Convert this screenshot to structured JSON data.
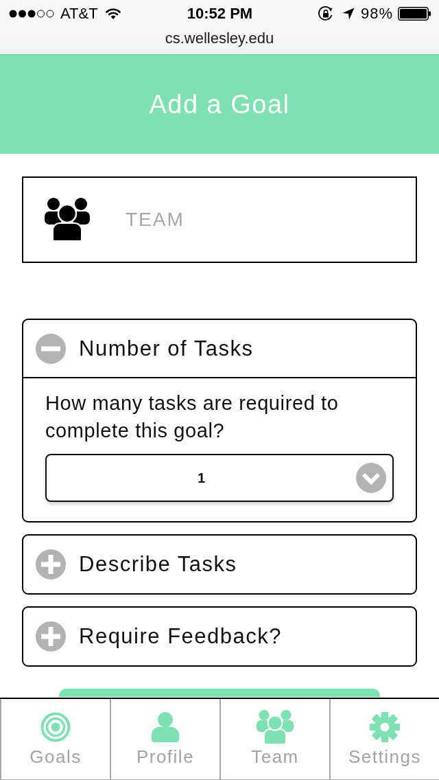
{
  "status_bar": {
    "carrier": "AT&T",
    "time": "10:52 PM",
    "battery": "98%"
  },
  "address_bar": {
    "url": "cs.wellesley.edu"
  },
  "header": {
    "title": "Add a Goal"
  },
  "team_field": {
    "placeholder": "TEAM"
  },
  "sections": [
    {
      "title": "Number of Tasks",
      "expanded": true,
      "question": "How many tasks are required to complete this goal?",
      "select": {
        "value": "1"
      }
    },
    {
      "title": "Describe Tasks",
      "expanded": false
    },
    {
      "title": "Require Feedback?",
      "expanded": false
    }
  ],
  "tab_bar": [
    {
      "label": "Goals",
      "kind": "target"
    },
    {
      "label": "Profile",
      "kind": "person"
    },
    {
      "label": "Team",
      "kind": "group"
    },
    {
      "label": "Settings",
      "kind": "gear"
    }
  ]
}
